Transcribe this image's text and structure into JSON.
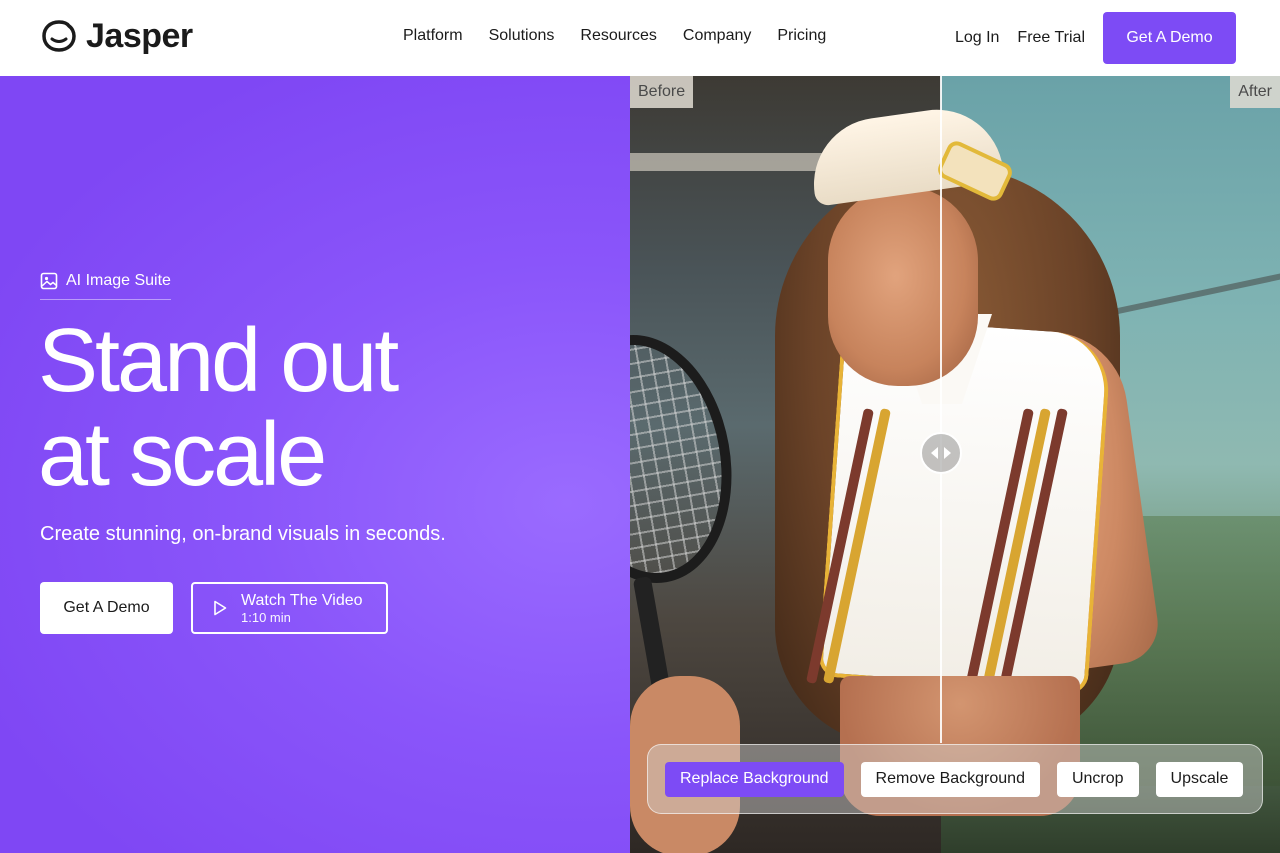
{
  "nav": {
    "brand": "Jasper",
    "links": [
      "Platform",
      "Solutions",
      "Resources",
      "Company",
      "Pricing"
    ],
    "login": "Log In",
    "free_trial": "Free Trial",
    "cta": "Get A Demo"
  },
  "hero": {
    "eyebrow": "AI Image Suite",
    "headline_line1": "Stand out",
    "headline_line2": "at scale",
    "subheadline": "Create stunning, on-brand visuals in seconds.",
    "primary_button": "Get A Demo",
    "video_button": "Watch The Video",
    "video_duration": "1:10 min"
  },
  "compare": {
    "before_label": "Before",
    "after_label": "After",
    "slider_position": 0.48,
    "tools": [
      {
        "label": "Replace Background",
        "active": true
      },
      {
        "label": "Remove Background",
        "active": false
      },
      {
        "label": "Uncrop",
        "active": false
      },
      {
        "label": "Upscale",
        "active": false
      }
    ]
  },
  "colors": {
    "accent": "#7d4bf5",
    "hero_bg": "#8a55fa",
    "text_dark": "#1b1b1b"
  }
}
